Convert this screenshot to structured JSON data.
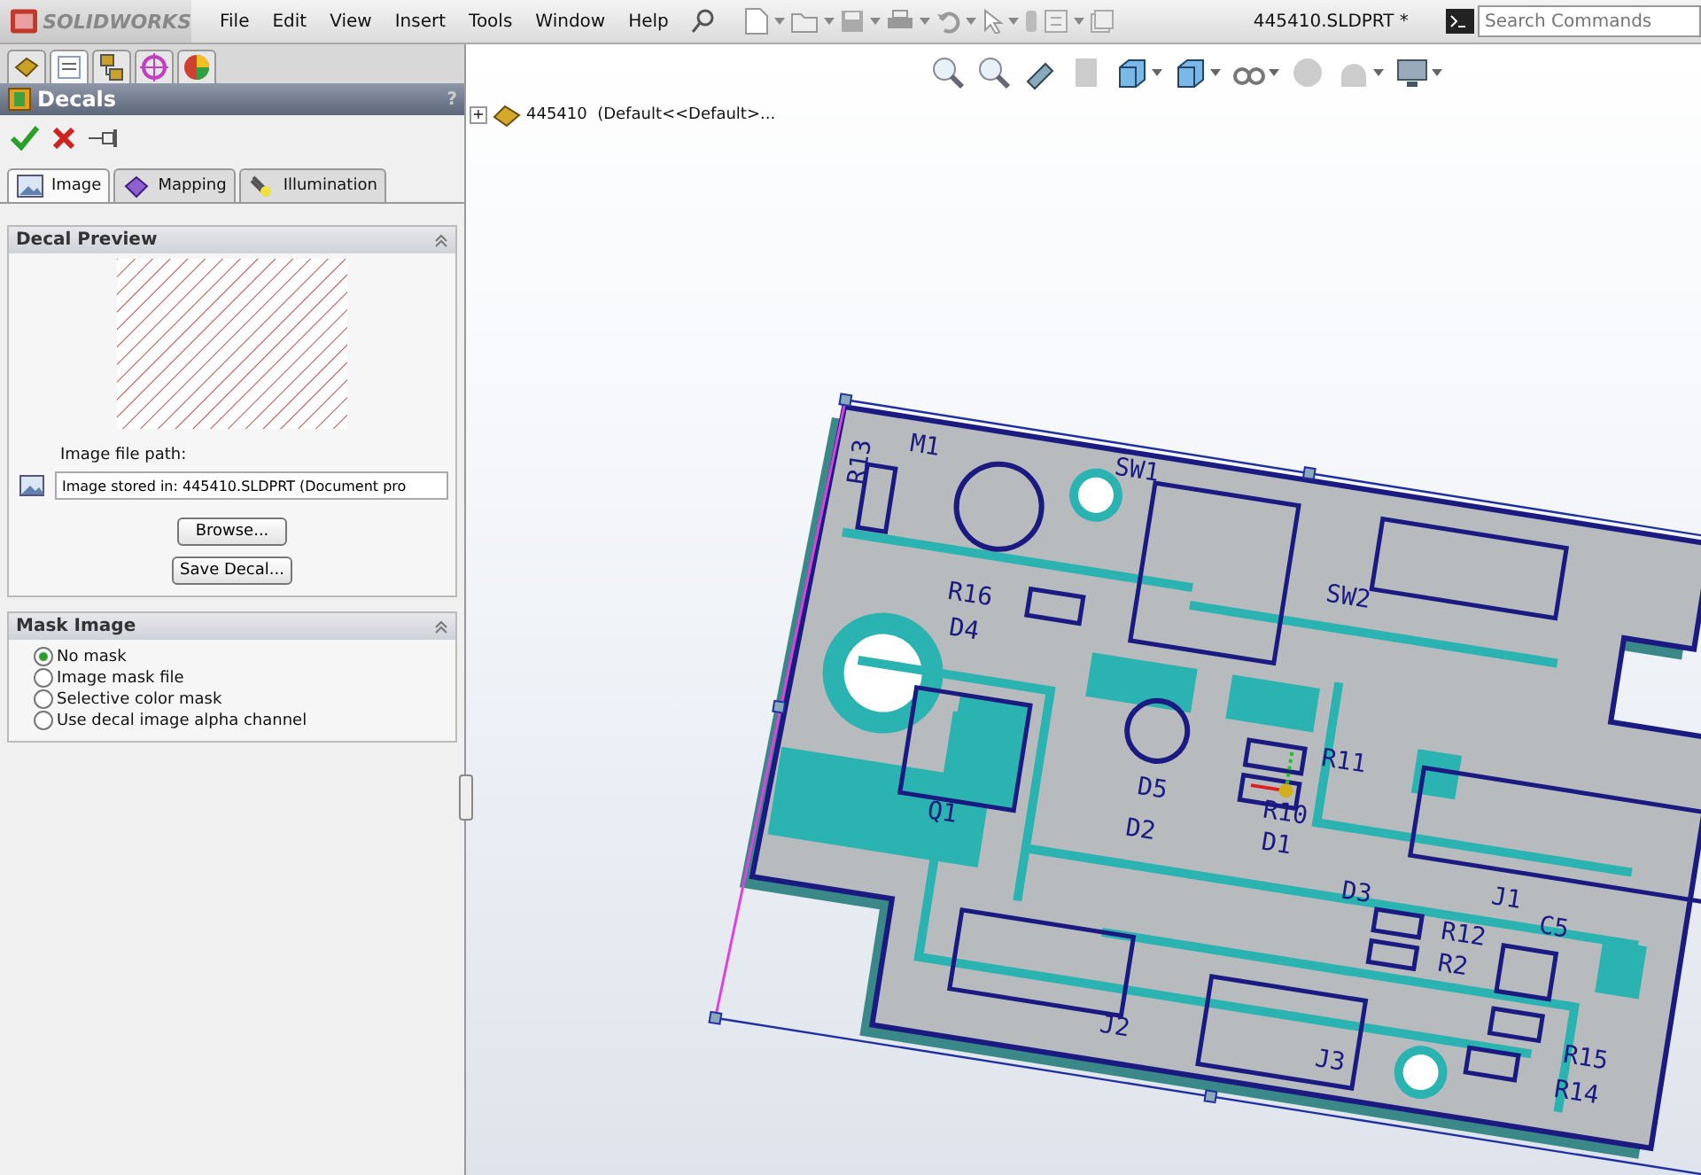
{
  "app": {
    "logo": "SOLIDWORKS",
    "menu": [
      "File",
      "Edit",
      "View",
      "Insert",
      "Tools",
      "Window",
      "Help"
    ],
    "document_title": "445410.SLDPRT *",
    "search": {
      "placeholder": "Search Commands"
    }
  },
  "panel_tabs": [
    {
      "kind": "feature",
      "selected": false
    },
    {
      "kind": "property",
      "selected": true
    },
    {
      "kind": "config",
      "selected": false
    },
    {
      "kind": "dimxpert",
      "selected": false
    },
    {
      "kind": "display",
      "selected": false
    }
  ],
  "property_manager": {
    "title": "Decals",
    "help": "?",
    "tabs": [
      {
        "label": "Image",
        "kind": "image",
        "selected": true
      },
      {
        "label": "Mapping",
        "kind": "mapping",
        "selected": false
      },
      {
        "label": "Illumination",
        "kind": "illumination",
        "selected": false
      }
    ],
    "decal_preview": {
      "title": "Decal Preview",
      "path_label": "Image file path:",
      "path_value": "Image stored in: 445410.SLDPRT (Document pro",
      "buttons": [
        "Browse...",
        "Save Decal..."
      ]
    },
    "mask_image": {
      "title": "Mask Image",
      "options": [
        {
          "label": "No mask",
          "selected": true
        },
        {
          "label": "Image mask file",
          "selected": false
        },
        {
          "label": "Selective color mask",
          "selected": false
        },
        {
          "label": "Use decal image alpha channel",
          "selected": false
        }
      ]
    }
  },
  "tree": {
    "expand": "+",
    "label": "445410  (Default<<Default>..."
  },
  "board": {
    "labels": [
      "M1",
      "R13",
      "SW1",
      "R16",
      "D4",
      "SW2",
      "Q1",
      "D5",
      "R11",
      "R10",
      "D2",
      "D1",
      "J1",
      "D3",
      "R12",
      "R2",
      "C5",
      "J2",
      "J3",
      "R15",
      "R14"
    ]
  }
}
